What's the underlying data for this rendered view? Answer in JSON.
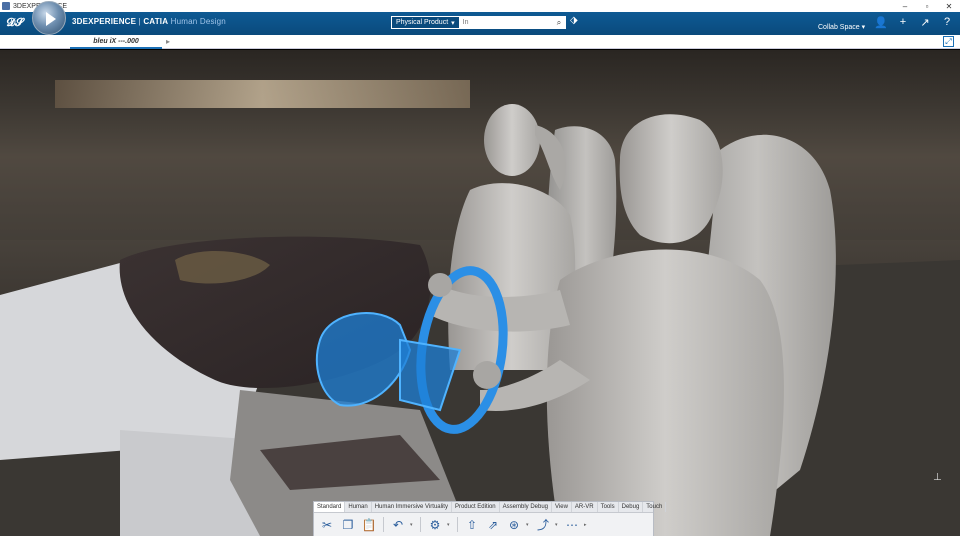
{
  "os_window": {
    "title": "3DEXPERIENCE",
    "controls": [
      "–",
      "▫",
      "✕"
    ]
  },
  "header": {
    "brand": "3DEXPERIENCE",
    "separator": " | ",
    "product": "CATIA",
    "app_name": "Human Design",
    "search_scope": "Physical Product",
    "search_placeholder": "In",
    "collab_space": "Collab Space"
  },
  "tabs": [
    {
      "label": "bleu iX ---.000"
    }
  ],
  "action_bar": {
    "tabs": [
      "Standard",
      "Human",
      "Human Immersive Virtuality",
      "Product Edition",
      "Assembly Debug",
      "View",
      "AR-VR",
      "Tools",
      "Debug",
      "Touch"
    ],
    "active_tab": "Standard"
  },
  "colors": {
    "top_bar": "#0a4a7c",
    "highlight": "#1e7fd6"
  }
}
